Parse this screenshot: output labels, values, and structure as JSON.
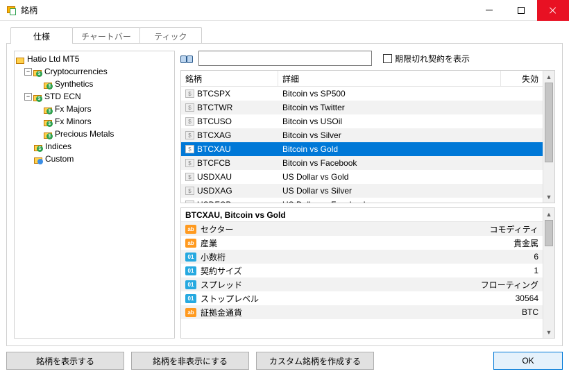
{
  "window": {
    "title": "銘柄"
  },
  "tabs": {
    "spec": "仕様",
    "chartbar": "チャートバー",
    "tick": "ティック"
  },
  "tree": {
    "root": "Hatio Ltd MT5",
    "n1": "Cryptocurrencies",
    "n1a": "Synthetics",
    "n2": "STD ECN",
    "n2a": "Fx Majors",
    "n2b": "Fx Minors",
    "n2c": "Precious Metals",
    "n3": "Indices",
    "n4": "Custom"
  },
  "toolbar": {
    "search_placeholder": "",
    "show_expired": "期限切れ契約を表示"
  },
  "grid": {
    "h1": "銘柄",
    "h2": "詳細",
    "h3": "失効",
    "rows": [
      {
        "sym": "BTCSPX",
        "desc": "Bitcoin vs SP500"
      },
      {
        "sym": "BTCTWR",
        "desc": "Bitcoin vs Twitter"
      },
      {
        "sym": "BTCUSO",
        "desc": "Bitcoin vs USOil"
      },
      {
        "sym": "BTCXAG",
        "desc": "Bitcoin vs Silver"
      },
      {
        "sym": "BTCXAU",
        "desc": "Bitcoin vs Gold"
      },
      {
        "sym": "BTCFCB",
        "desc": "Bitcoin vs Facebook"
      },
      {
        "sym": "USDXAU",
        "desc": "US Dollar vs Gold"
      },
      {
        "sym": "USDXAG",
        "desc": "US Dollar vs Silver"
      },
      {
        "sym": "USDFCB",
        "desc": "US Dollar vs Facebook"
      }
    ]
  },
  "detail": {
    "title": "BTCXAU, Bitcoin vs Gold",
    "rows": [
      {
        "k": "セクター",
        "v": "コモディティ",
        "t": "ab"
      },
      {
        "k": "産業",
        "v": "貴金属",
        "t": "ab"
      },
      {
        "k": "小数桁",
        "v": "6",
        "t": "n01"
      },
      {
        "k": "契約サイズ",
        "v": "1",
        "t": "n01"
      },
      {
        "k": "スプレッド",
        "v": "フローティング",
        "t": "n01"
      },
      {
        "k": "ストップレベル",
        "v": "30564",
        "t": "n01"
      },
      {
        "k": "証拠金通貨",
        "v": "BTC",
        "t": "ab"
      }
    ]
  },
  "buttons": {
    "show": "銘柄を表示する",
    "hide": "銘柄を非表示にする",
    "custom": "カスタム銘柄を作成する",
    "ok": "OK"
  }
}
